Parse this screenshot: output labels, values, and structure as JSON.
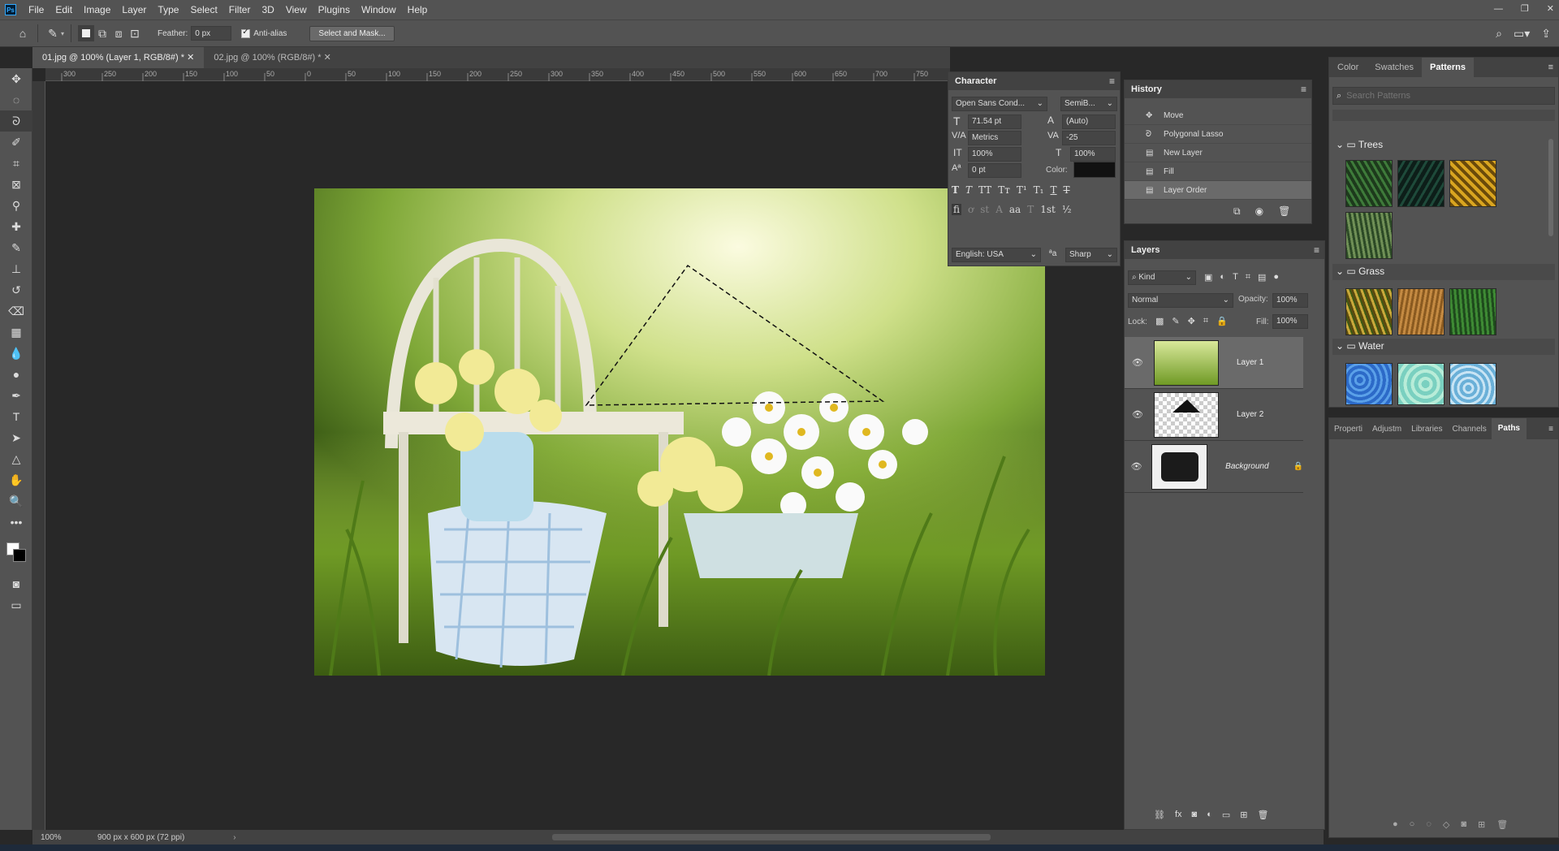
{
  "app": {
    "logo": "Ps"
  },
  "menu": [
    "File",
    "Edit",
    "Image",
    "Layer",
    "Type",
    "Select",
    "Filter",
    "3D",
    "View",
    "Plugins",
    "Window",
    "Help"
  ],
  "options": {
    "feather_label": "Feather:",
    "feather_value": "0 px",
    "antialias_label": "Anti-alias",
    "select_mask": "Select and Mask..."
  },
  "tabs": [
    {
      "label": "01.jpg @ 100% (Layer 1, RGB/8#) *"
    },
    {
      "label": "02.jpg @ 100% (RGB/8#) *"
    }
  ],
  "ruler": [
    "300",
    "250",
    "200",
    "150",
    "100",
    "50",
    "0",
    "50",
    "100",
    "150",
    "200",
    "250",
    "300",
    "350",
    "400",
    "450",
    "500",
    "550",
    "600",
    "650",
    "700",
    "750"
  ],
  "status": {
    "zoom": "100%",
    "doc_info": "900 px x 600 px (72 ppi)"
  },
  "character": {
    "title": "Character",
    "font_family": "Open Sans Cond...",
    "font_style": "SemiB...",
    "size": "71.54 pt",
    "leading": "(Auto)",
    "kerning": "Metrics",
    "tracking": "-25",
    "vscale": "100%",
    "hscale": "100%",
    "baseline": "0 pt",
    "color_label": "Color:",
    "language": "English: USA",
    "antialias": "Sharp",
    "style_buttons": [
      "T",
      "T",
      "TT",
      "Tт",
      "T¹",
      "T₁",
      "T",
      "T"
    ],
    "ot_buttons": [
      "fi",
      "ơ",
      "st",
      "A",
      "aa",
      "T",
      "1st",
      "½"
    ]
  },
  "history": {
    "title": "History",
    "items": [
      "Move",
      "Polygonal Lasso",
      "New Layer",
      "Fill",
      "Layer Order"
    ]
  },
  "layers": {
    "title": "Layers",
    "kind": "Kind",
    "blend": "Normal",
    "opacity_label": "Opacity:",
    "opacity": "100%",
    "lock_label": "Lock:",
    "fill_label": "Fill:",
    "fill": "100%",
    "items": [
      {
        "name": "Layer 1"
      },
      {
        "name": "Layer 2"
      },
      {
        "name": "Background"
      }
    ]
  },
  "right_tabs": [
    "Color",
    "Swatches",
    "Patterns"
  ],
  "patterns": {
    "search_placeholder": "Search Patterns",
    "groups": [
      "Trees",
      "Grass",
      "Water"
    ]
  },
  "bottom_tabs": [
    "Properti",
    "Adjustm",
    "Libraries",
    "Channels",
    "Paths"
  ],
  "colors": {
    "accent": "#31a8ff",
    "panel": "#535353",
    "dark": "#282828"
  }
}
